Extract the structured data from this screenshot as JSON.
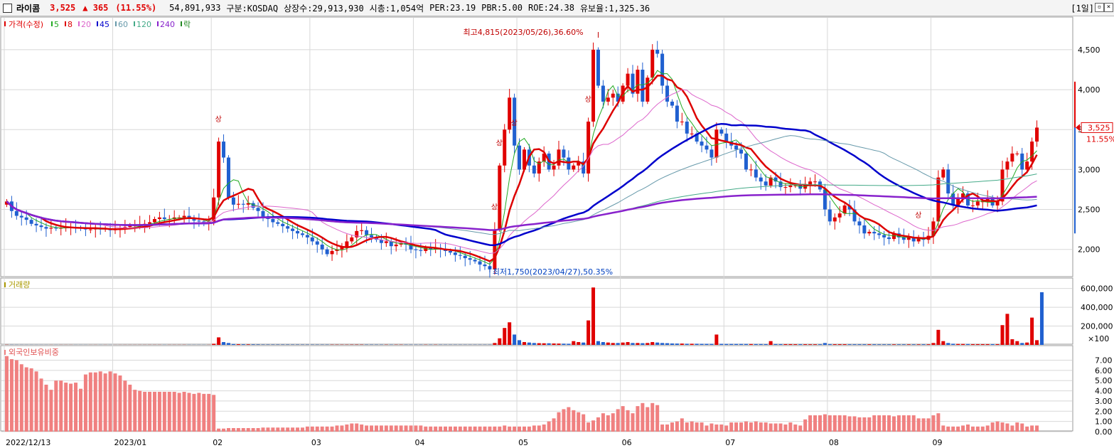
{
  "header": {
    "name": "라이콤",
    "price": "3,525",
    "change": "▲ 365",
    "change_pct": "(11.55%)",
    "volume": "54,891,933",
    "market": "구분:KOSDAQ",
    "shares": "상장수:29,913,930",
    "market_cap": "시총:1,054억",
    "per": "PER:23.19",
    "pbr": "PBR:5.00",
    "roe": "ROE:24.38",
    "float_ratio": "유보율:1,325.36",
    "period": "[1일]"
  },
  "legend": {
    "price_label": "가격(수정)",
    "ma": [
      {
        "label": "5",
        "color": "#22aa22"
      },
      {
        "label": "8",
        "color": "#dd0000"
      },
      {
        "label": "20",
        "color": "#dd66cc"
      },
      {
        "label": "45",
        "color": "#0000cc"
      },
      {
        "label": "60",
        "color": "#6699aa"
      },
      {
        "label": "120",
        "color": "#44aa88"
      },
      {
        "label": "240",
        "color": "#8822cc"
      }
    ],
    "fall_label": "락",
    "volume_label": "거래량",
    "foreign_label": "외국인보유비중"
  },
  "annotations": {
    "high": "최고4,815(2023/05/26),36.60%",
    "low": "최저1,750(2023/04/27),50.35%",
    "limit_up": "상"
  },
  "last_price_box": {
    "price": "3,525",
    "pct": "11.55%"
  },
  "colors": {
    "up": "#e00000",
    "down": "#2060d0",
    "grid": "#d8d8d8"
  },
  "chart_data": [
    {
      "type": "candlestick",
      "title": "가격(수정)",
      "x_tick_labels": [
        "2022/12/13",
        "2023/01",
        "02",
        "03",
        "04",
        "05",
        "06",
        "07",
        "08",
        "09"
      ],
      "y_tick_labels": [
        "2,000",
        "2,500",
        "3,000",
        "3,500",
        "4,000",
        "4,500"
      ],
      "ylim": [
        1650,
        4900
      ],
      "close": [
        2600,
        2480,
        2420,
        2400,
        2370,
        2320,
        2300,
        2280,
        2260,
        2270,
        2260,
        2270,
        2280,
        2280,
        2270,
        2260,
        2250,
        2250,
        2260,
        2250,
        2260,
        2240,
        2250,
        2260,
        2280,
        2300,
        2300,
        2310,
        2320,
        2340,
        2380,
        2400,
        2380,
        2380,
        2400,
        2400,
        2420,
        2380,
        2360,
        2350,
        2320,
        2350,
        2650,
        3350,
        3150,
        2650,
        2560,
        2570,
        2560,
        2580,
        2520,
        2480,
        2400,
        2380,
        2340,
        2320,
        2290,
        2260,
        2230,
        2200,
        2180,
        2150,
        2100,
        2060,
        2000,
        1940,
        1980,
        2000,
        2030,
        2100,
        2150,
        2230,
        2240,
        2180,
        2150,
        2120,
        2080,
        2100,
        2040,
        2060,
        2080,
        2060,
        2000,
        1990,
        1980,
        2020,
        2000,
        2020,
        2000,
        1980,
        1960,
        1930,
        1920,
        1890,
        1870,
        1850,
        1810,
        1790,
        1750,
        2250,
        3050,
        3500,
        3900,
        3300,
        3000,
        3250,
        3050,
        2950,
        3100,
        3200,
        3000,
        3050,
        3250,
        3150,
        3000,
        3050,
        3100,
        2950,
        3600,
        4500,
        4050,
        3850,
        3900,
        3950,
        3850,
        4050,
        4200,
        3950,
        4250,
        3850,
        4150,
        4500,
        4450,
        4050,
        3850,
        3800,
        3600,
        3600,
        3450,
        3450,
        3350,
        3300,
        3250,
        3150,
        3500,
        3450,
        3350,
        3300,
        3250,
        3200,
        3000,
        3000,
        2900,
        2850,
        2800,
        2900,
        2850,
        2780,
        2780,
        2800,
        2800,
        2760,
        2800,
        2850,
        2850,
        2750,
        2500,
        2350,
        2400,
        2450,
        2550,
        2500,
        2350,
        2300,
        2200,
        2220,
        2200,
        2180,
        2150,
        2130,
        2200,
        2150,
        2120,
        2150,
        2100,
        2150,
        2120,
        2170,
        2350,
        2900,
        3000,
        2700,
        2550,
        2650,
        2700,
        2550,
        2550,
        2600,
        2600,
        2650,
        2550,
        2600,
        3000,
        3100,
        3200,
        3200,
        3000,
        3100,
        3350,
        3525
      ],
      "series": [
        {
          "name": "5"
        },
        {
          "name": "8"
        },
        {
          "name": "20"
        },
        {
          "name": "45"
        },
        {
          "name": "60"
        },
        {
          "name": "120"
        },
        {
          "name": "240"
        }
      ]
    },
    {
      "type": "bar",
      "title": "거래량",
      "y_tick_labels": [
        "600,000",
        "400,000",
        "200,000",
        "×100"
      ],
      "ylim": [
        0,
        650000
      ],
      "values": [
        1500,
        1200,
        1000,
        900,
        800,
        800,
        700,
        700,
        700,
        600,
        700,
        700,
        600,
        600,
        600,
        600,
        600,
        500,
        600,
        600,
        600,
        600,
        500,
        600,
        700,
        700,
        700,
        800,
        800,
        900,
        900,
        900,
        800,
        900,
        900,
        900,
        1100,
        1000,
        900,
        900,
        800,
        900,
        12000,
        80000,
        30000,
        20000,
        9000,
        7000,
        6000,
        5000,
        5000,
        4000,
        3000,
        3000,
        3000,
        3000,
        3000,
        3000,
        2800,
        2800,
        2600,
        2600,
        2500,
        2400,
        2300,
        2300,
        2200,
        2200,
        2100,
        2100,
        2500,
        2600,
        2400,
        2300,
        2300,
        2200,
        2100,
        2100,
        2000,
        2000,
        2000,
        2000,
        1900,
        1900,
        1800,
        1800,
        1800,
        1800,
        1800,
        1700,
        1700,
        1700,
        1700,
        1600,
        1600,
        1600,
        1700,
        1700,
        1800,
        20000,
        70000,
        180000,
        240000,
        110000,
        50000,
        30000,
        25000,
        20000,
        18000,
        17000,
        17000,
        15000,
        14000,
        13000,
        12000,
        40000,
        30000,
        25000,
        260000,
        610000,
        40000,
        30000,
        25000,
        20000,
        20000,
        25000,
        30000,
        20000,
        20000,
        18000,
        20000,
        30000,
        25000,
        20000,
        18000,
        15000,
        14000,
        14000,
        12000,
        12000,
        12000,
        11000,
        11000,
        11000,
        110000,
        11000,
        10000,
        10000,
        10000,
        10000,
        10000,
        9000,
        9000,
        9000,
        8000,
        40000,
        9000,
        8000,
        8000,
        8000,
        7000,
        7000,
        7000,
        6000,
        6000,
        6000,
        20000,
        8000,
        7000,
        7000,
        7000,
        6000,
        6000,
        6000,
        6000,
        6000,
        6000,
        5000,
        5000,
        5000,
        5000,
        5000,
        5000,
        5000,
        5000,
        5000,
        6000,
        6000,
        20000,
        160000,
        40000,
        20000,
        12000,
        10000,
        10000,
        9000,
        8000,
        8000,
        8000,
        8000,
        8000,
        8000,
        210000,
        330000,
        60000,
        40000,
        20000,
        25000,
        290000,
        50000,
        560000
      ]
    },
    {
      "type": "bar",
      "title": "외국인보유비중",
      "y_tick_labels": [
        "7.00",
        "6.00",
        "5.00",
        "4.00",
        "3.00",
        "2.00",
        "1.00",
        "0.00"
      ],
      "ylim": [
        0,
        7.8
      ],
      "values": [
        7.4,
        7.1,
        7.0,
        6.6,
        6.3,
        6.2,
        5.9,
        5.2,
        4.6,
        4.1,
        5.0,
        5.0,
        4.8,
        4.7,
        4.8,
        4.2,
        5.6,
        5.8,
        5.8,
        5.9,
        5.7,
        5.9,
        5.7,
        5.5,
        5.0,
        4.6,
        4.1,
        4.0,
        3.9,
        3.9,
        3.9,
        3.9,
        3.9,
        3.9,
        3.9,
        3.8,
        3.9,
        3.8,
        3.7,
        3.8,
        3.7,
        3.7,
        3.6,
        0.3,
        0.3,
        0.35,
        0.35,
        0.35,
        0.35,
        0.35,
        0.35,
        0.35,
        0.4,
        0.4,
        0.4,
        0.4,
        0.4,
        0.4,
        0.4,
        0.4,
        0.4,
        0.5,
        0.5,
        0.5,
        0.5,
        0.5,
        0.5,
        0.6,
        0.6,
        0.7,
        0.8,
        0.8,
        0.7,
        0.6,
        0.6,
        0.6,
        0.6,
        0.6,
        0.6,
        0.6,
        0.6,
        0.6,
        0.6,
        0.6,
        0.6,
        0.5,
        0.5,
        0.5,
        0.5,
        0.5,
        0.5,
        0.5,
        0.5,
        0.5,
        0.5,
        0.5,
        0.5,
        0.5,
        0.5,
        0.5,
        0.5,
        0.6,
        0.5,
        0.5,
        0.5,
        0.5,
        0.5,
        0.6,
        0.6,
        0.7,
        1.0,
        1.3,
        1.9,
        2.2,
        2.4,
        2.1,
        1.9,
        1.7,
        0.9,
        1.1,
        1.4,
        1.8,
        1.6,
        1.8,
        2.2,
        2.5,
        2.1,
        1.8,
        2.5,
        2.8,
        2.4,
        2.8,
        2.6,
        0.7,
        0.7,
        0.9,
        1.0,
        1.3,
        0.9,
        1.0,
        0.9,
        0.9,
        0.6,
        0.8,
        0.7,
        0.7,
        0.6,
        0.9,
        0.9,
        0.9,
        1.0,
        0.9,
        1.0,
        0.9,
        0.9,
        0.8,
        0.8,
        0.8,
        0.7,
        0.9,
        0.7,
        0.6,
        1.2,
        1.6,
        1.6,
        1.6,
        1.7,
        1.6,
        1.6,
        1.6,
        1.6,
        1.5,
        1.5,
        1.4,
        1.4,
        1.4,
        1.6,
        1.6,
        1.6,
        1.6,
        1.5,
        1.6,
        1.6,
        1.6,
        1.6,
        1.3,
        1.3,
        1.3,
        1.6,
        1.8,
        0.6,
        0.5,
        0.5,
        0.5,
        0.6,
        0.7,
        0.5,
        0.5,
        0.5,
        0.6,
        0.9,
        1.0,
        0.9,
        0.8,
        0.6,
        0.9,
        0.8,
        0.5,
        0.6,
        0.6
      ]
    }
  ]
}
